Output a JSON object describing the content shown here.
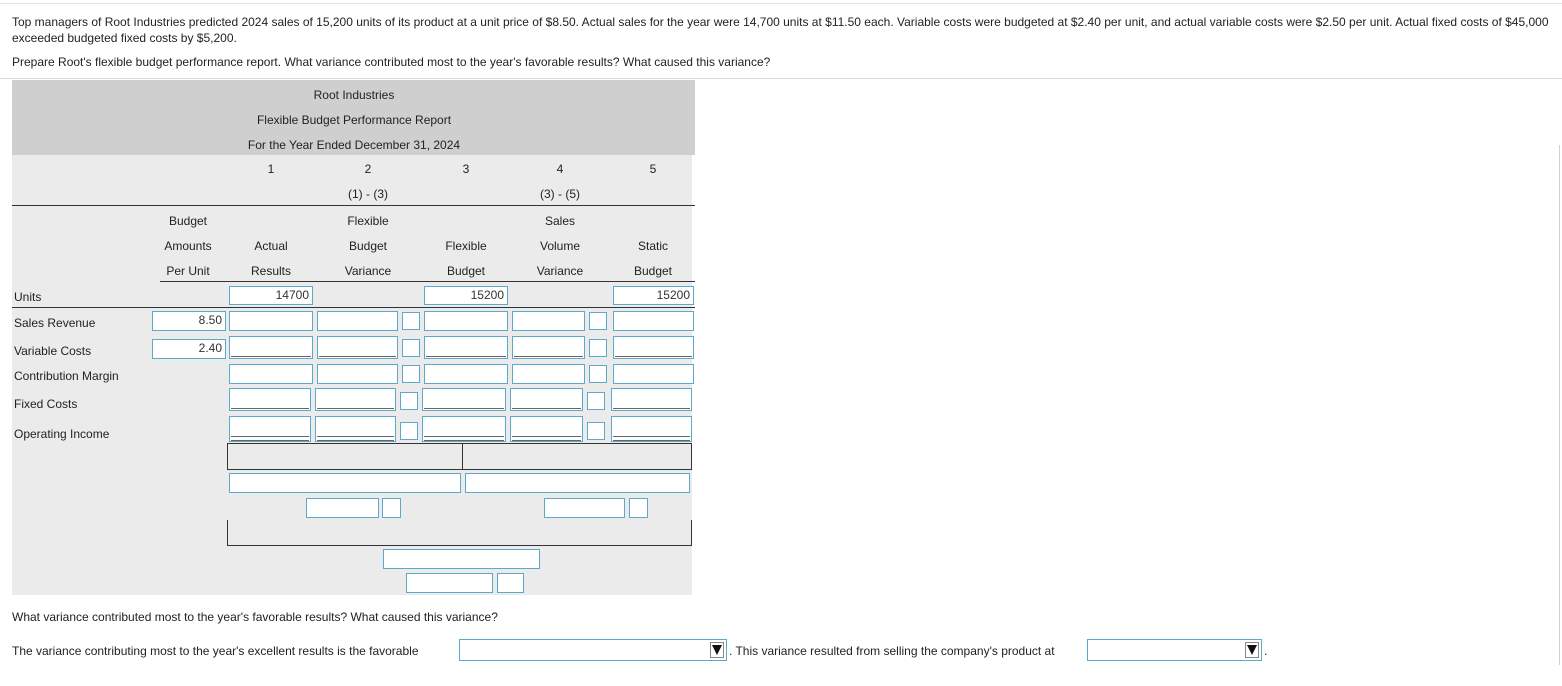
{
  "problem": {
    "text": "Top managers of Root Industries predicted 2024 sales of 15,200 units of its product at a unit price of $8.50. Actual sales for the year were 14,700 units at $11.50 each. Variable costs were budgeted at $2.40 per unit, and actual variable costs were $2.50 per unit. Actual fixed costs of $45,000 exceeded budgeted fixed costs by $5,200.",
    "instruction": "Prepare Root's flexible budget performance report. What variance contributed most to the year's favorable results? What caused this variance?"
  },
  "report": {
    "company": "Root Industries",
    "title": "Flexible Budget Performance Report",
    "period": "For the Year Ended December 31, 2024",
    "col_numbers": [
      "1",
      "2",
      "3",
      "4",
      "5"
    ],
    "col_formulas": {
      "c2": "(1) - (3)",
      "c4": "(3) - (5)"
    },
    "headers": {
      "per_unit": [
        "Budget",
        "Amounts",
        "Per Unit"
      ],
      "actual": [
        "Actual",
        "Results"
      ],
      "flex_var": [
        "Flexible",
        "Budget",
        "Variance"
      ],
      "flex_budget": [
        "Flexible",
        "Budget"
      ],
      "sales_vol": [
        "Sales",
        "Volume",
        "Variance"
      ],
      "static": [
        "Static",
        "Budget"
      ]
    },
    "rows": {
      "units": "Units",
      "sales_revenue": "Sales Revenue",
      "variable_costs": "Variable Costs",
      "contribution_margin": "Contribution Margin",
      "fixed_costs": "Fixed Costs",
      "operating_income": "Operating Income"
    },
    "values": {
      "units_actual": "14700",
      "units_flex": "15200",
      "units_static": "15200",
      "sales_per_unit": "8.50",
      "var_per_unit": "2.40"
    }
  },
  "question": {
    "prompt": "What variance contributed most to the year's favorable results? What caused this variance?",
    "sentence_start": "The variance contributing most to the year's excellent results is the favorable",
    "sentence_mid": ". This variance resulted from selling the company's product at",
    "sentence_end": "."
  }
}
